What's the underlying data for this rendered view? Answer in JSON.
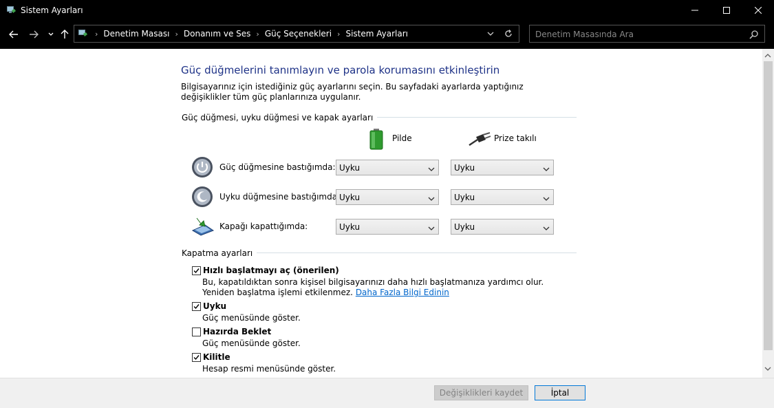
{
  "window": {
    "title": "Sistem Ayarları"
  },
  "address": {
    "crumbs": [
      "Denetim Masası",
      "Donanım ve Ses",
      "Güç Seçenekleri",
      "Sistem Ayarları"
    ]
  },
  "search": {
    "placeholder": "Denetim Masasında Ara"
  },
  "page": {
    "heading": "Güç düğmelerini tanımlayın ve parola korumasını etkinleştirin",
    "intro": "Bilgisayarınız için istediğiniz güç ayarlarını seçin. Bu sayfadaki ayarlarda yaptığınız değişiklikler tüm güç planlarınıza uygulanır."
  },
  "power_group": {
    "label": "Güç düğmesi, uyku düğmesi ve kapak ayarları",
    "col_battery": "Pilde",
    "col_plugged": "Prize takılı",
    "rows": [
      {
        "label": "Güç düğmesine bastığımda:",
        "battery": "Uyku",
        "plugged": "Uyku"
      },
      {
        "label": "Uyku düğmesine bastığımda:",
        "battery": "Uyku",
        "plugged": "Uyku"
      },
      {
        "label": "Kapağı kapattığımda:",
        "battery": "Uyku",
        "plugged": "Uyku"
      }
    ]
  },
  "shutdown_group": {
    "label": "Kapatma ayarları",
    "items": [
      {
        "title": "Hızlı başlatmayı aç (önerilen)",
        "checked": true,
        "desc": "Bu, kapatıldıktan sonra kişisel bilgisayarınızı daha hızlı başlatmanıza yardımcı olur. Yeniden başlatma işlemi etkilenmez.",
        "link": "Daha Fazla Bilgi Edinin"
      },
      {
        "title": "Uyku",
        "checked": true,
        "desc": "Güç menüsünde göster."
      },
      {
        "title": "Hazırda Beklet",
        "checked": false,
        "desc": "Güç menüsünde göster."
      },
      {
        "title": "Kilitle",
        "checked": true,
        "desc": "Hesap resmi menüsünde göster."
      }
    ]
  },
  "footer": {
    "save_label": "Değişiklikleri kaydet",
    "cancel_label": "İptal"
  },
  "colors": {
    "heading": "#1e3287",
    "link": "#0066cc",
    "titlebar": "#000000"
  }
}
